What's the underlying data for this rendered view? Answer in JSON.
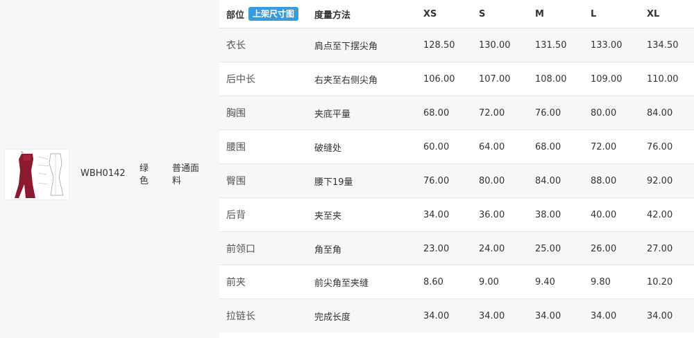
{
  "product": {
    "thumbnail_icon": "garment-sketch-image",
    "sku": "WBH0142",
    "color": "绿色",
    "fabric": "普通面料"
  },
  "table": {
    "headers": {
      "part": "部位",
      "badge": "上架尺寸图",
      "method": "度量方法",
      "sizes": [
        "XS",
        "S",
        "M",
        "L",
        "XL"
      ]
    },
    "rows": [
      {
        "part": "衣长",
        "method": "肩点至下摆尖角",
        "values": [
          "128.50",
          "130.00",
          "131.50",
          "133.00",
          "134.50"
        ]
      },
      {
        "part": "后中长",
        "method": "右夹至右侧尖角",
        "values": [
          "106.00",
          "107.00",
          "108.00",
          "109.00",
          "110.00"
        ]
      },
      {
        "part": "胸围",
        "method": "夹底平量",
        "values": [
          "68.00",
          "72.00",
          "76.00",
          "80.00",
          "84.00"
        ]
      },
      {
        "part": "腰围",
        "method": "破缝处",
        "values": [
          "60.00",
          "64.00",
          "68.00",
          "72.00",
          "76.00"
        ]
      },
      {
        "part": "臀围",
        "method": "腰下19量",
        "values": [
          "76.00",
          "80.00",
          "84.00",
          "88.00",
          "92.00"
        ]
      },
      {
        "part": "后背",
        "method": "夹至夹",
        "values": [
          "34.00",
          "36.00",
          "38.00",
          "40.00",
          "42.00"
        ]
      },
      {
        "part": "前领口",
        "method": "角至角",
        "values": [
          "23.00",
          "24.00",
          "25.00",
          "26.00",
          "27.00"
        ]
      },
      {
        "part": "前夹",
        "method": "前尖角至夹缝",
        "values": [
          "8.60",
          "9.00",
          "9.40",
          "9.80",
          "10.20"
        ]
      },
      {
        "part": "拉链长",
        "method": "完成长度",
        "values": [
          "34.00",
          "34.00",
          "34.00",
          "34.00",
          "34.00"
        ]
      }
    ]
  }
}
